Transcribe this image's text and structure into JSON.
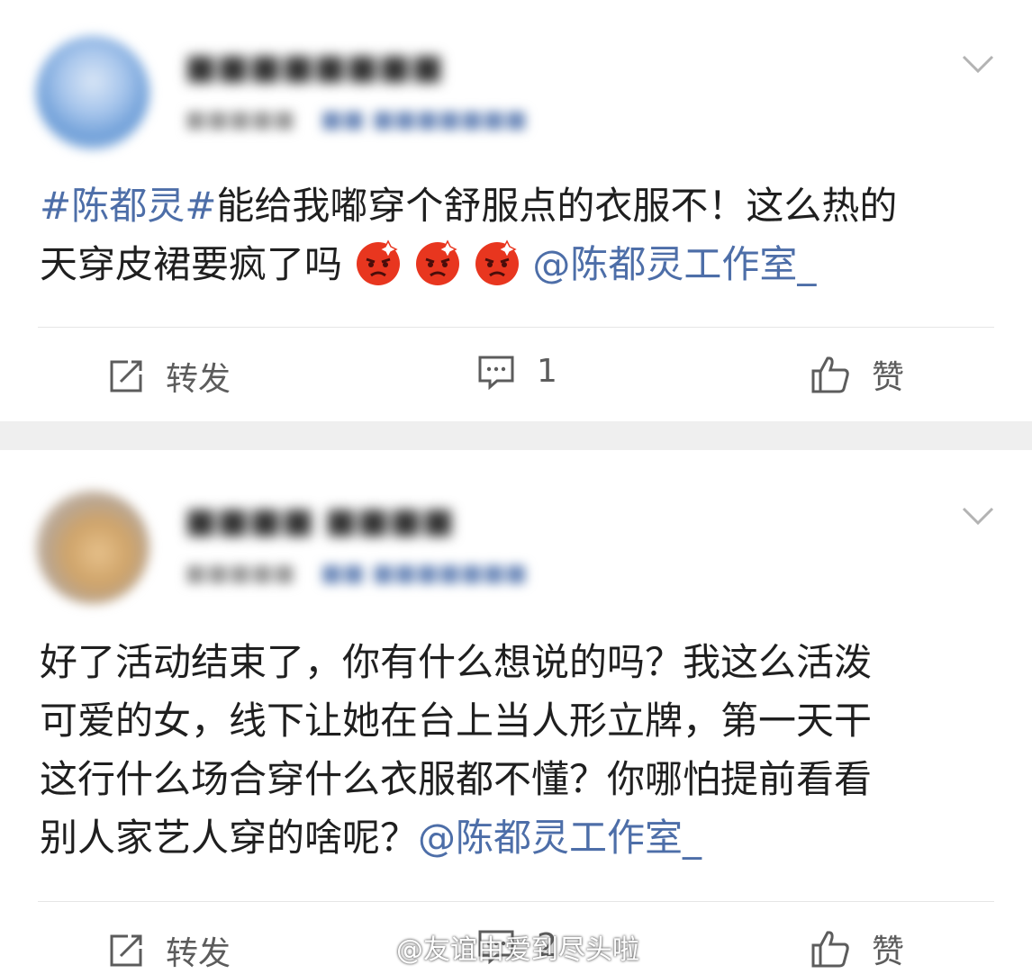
{
  "posts": [
    {
      "content_parts": {
        "hashtag": "#陈都灵#",
        "text_line1": "能给我嘟穿个舒服点的衣服不！这么热的",
        "text_line2": "天穿皮裙要疯了吗",
        "mention": "@陈都灵工作室_"
      },
      "emoji_count": 3,
      "emoji_name": "angry-face-emoji",
      "actions": {
        "repost": "转发",
        "comment": "1",
        "like": "赞"
      }
    },
    {
      "content_lines": [
        "好了活动结束了，你有什么想说的吗？我这么活泼",
        "可爱的女，线下让她在台上当人形立牌，第一天干",
        "这行什么场合穿什么衣服都不懂？你哪怕提前看看",
        "别人家艺人穿的啥呢？"
      ],
      "mention": "@陈都灵工作室_",
      "actions": {
        "repost": "转发",
        "comment": "2",
        "like": "赞"
      }
    }
  ],
  "watermark": "@友谊由爱到尽头啦",
  "colors": {
    "link": "#4d6ea8",
    "separator": "#efefef",
    "text": "#1f1f1f"
  }
}
